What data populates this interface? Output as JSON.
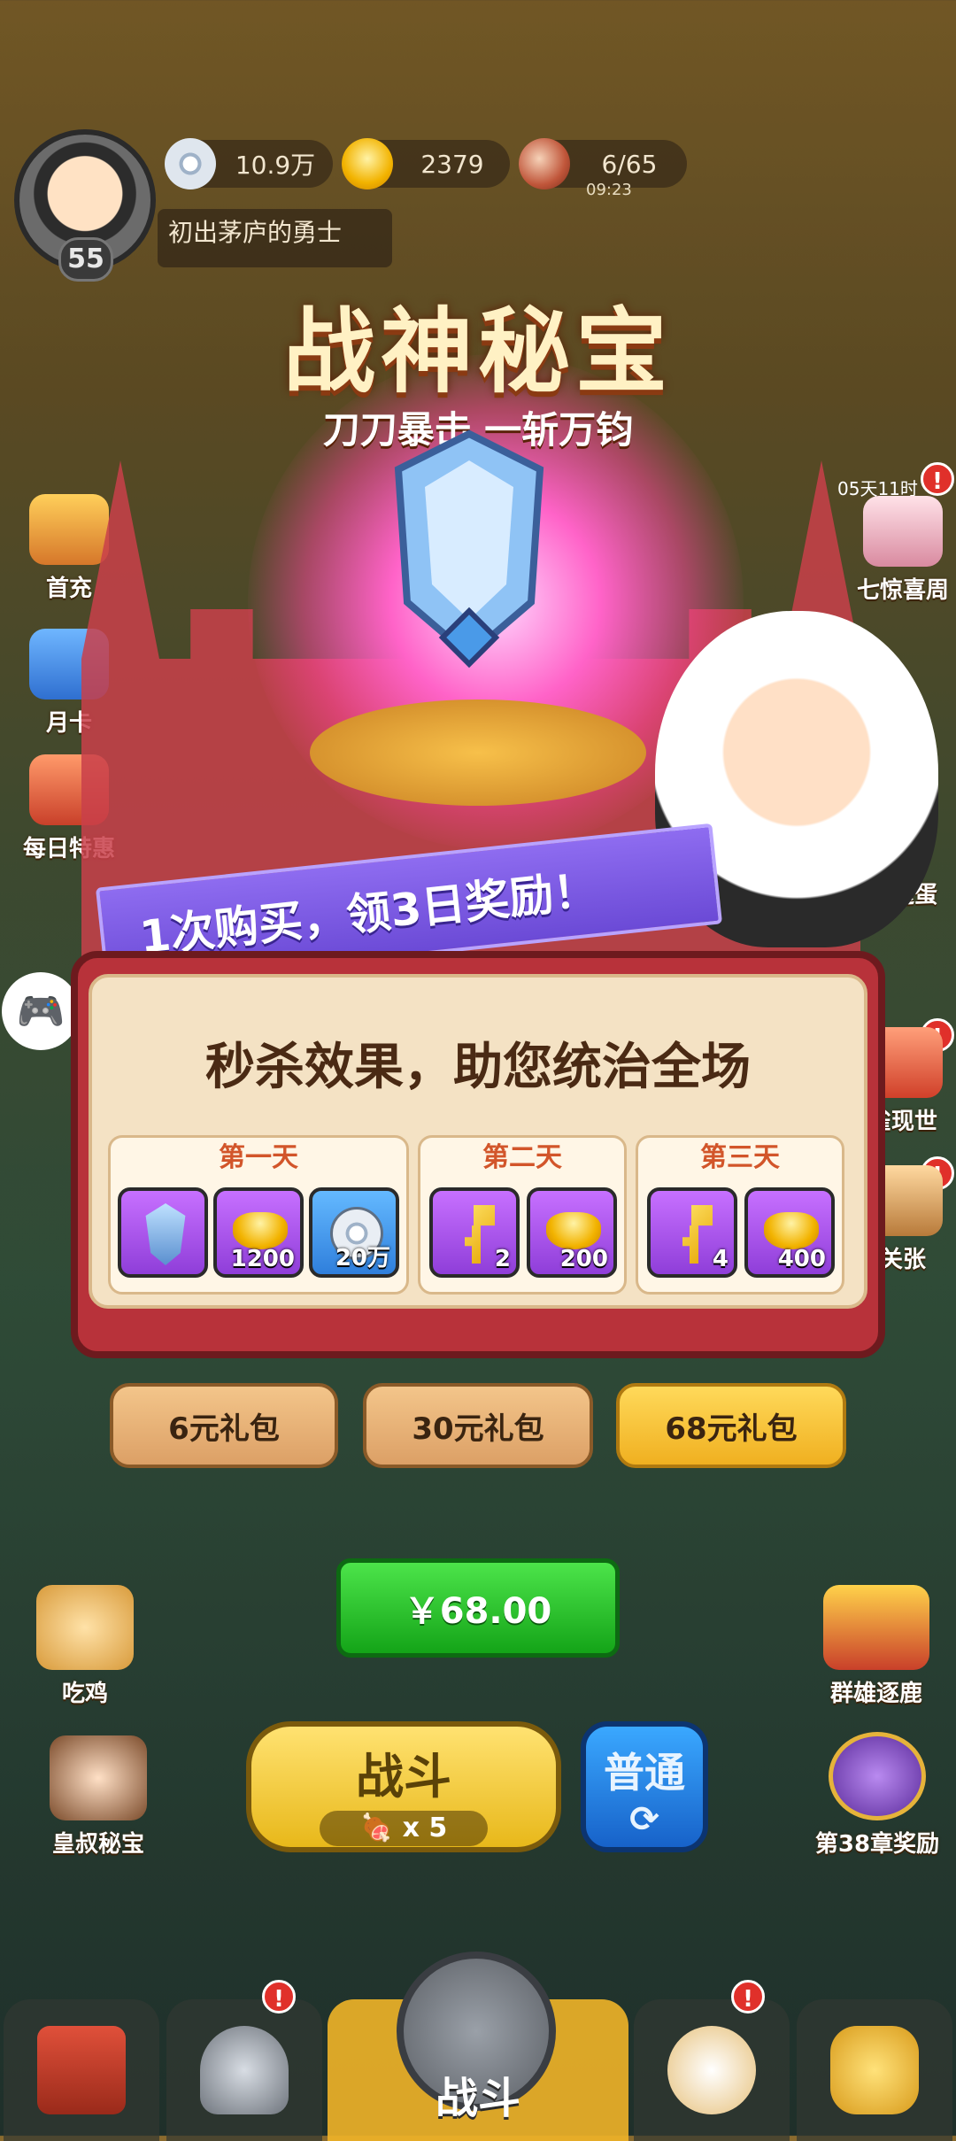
{
  "hud": {
    "level": "55",
    "title": "初出茅庐的勇士",
    "silver": "10.9万",
    "gold": "2379",
    "stamina": "6/65",
    "stamina_timer": "09:23"
  },
  "left_side": [
    "首充",
    "月卡",
    "每日特惠"
  ],
  "right_side": {
    "timer": "05天11时",
    "items": [
      "七惊喜周",
      "幸运蛋",
      "雀现世",
      "关张"
    ]
  },
  "banner": {
    "title": "战神秘宝",
    "subtitle": "刀刀暴击 一斩万钧",
    "ribbon": "1次购买，领3日奖励！",
    "headline": "秒杀效果，助您统治全场"
  },
  "days": [
    {
      "label": "第一天",
      "items": [
        {
          "icon": "helmet-icon",
          "qty": ""
        },
        {
          "icon": "gold-ingot-icon",
          "qty": "1200"
        },
        {
          "icon": "silver-coin-icon",
          "qty": "20万"
        }
      ]
    },
    {
      "label": "第二天",
      "items": [
        {
          "icon": "key-icon",
          "qty": "2"
        },
        {
          "icon": "gold-ingot-icon",
          "qty": "200"
        }
      ]
    },
    {
      "label": "第三天",
      "items": [
        {
          "icon": "key-icon",
          "qty": "4"
        },
        {
          "icon": "gold-ingot-icon",
          "qty": "400"
        }
      ]
    }
  ],
  "packages": [
    "6元礼包",
    "30元礼包",
    "68元礼包"
  ],
  "selected_package": 2,
  "buy_button": "￥68.00",
  "lower_left": [
    "吃鸡",
    "皇叔秘宝"
  ],
  "lower_right": [
    "群雄逐鹿",
    "第38章奖励"
  ],
  "battle": {
    "label": "战斗",
    "cost": "x 5"
  },
  "mode": {
    "label": "普通"
  },
  "bottom_nav": {
    "center_label": "战斗"
  },
  "colors": {
    "accent_gold": "#f0b020",
    "buy_green": "#14a418",
    "ribbon_purple": "#6b4ad6",
    "panel_red": "#b8323a"
  }
}
